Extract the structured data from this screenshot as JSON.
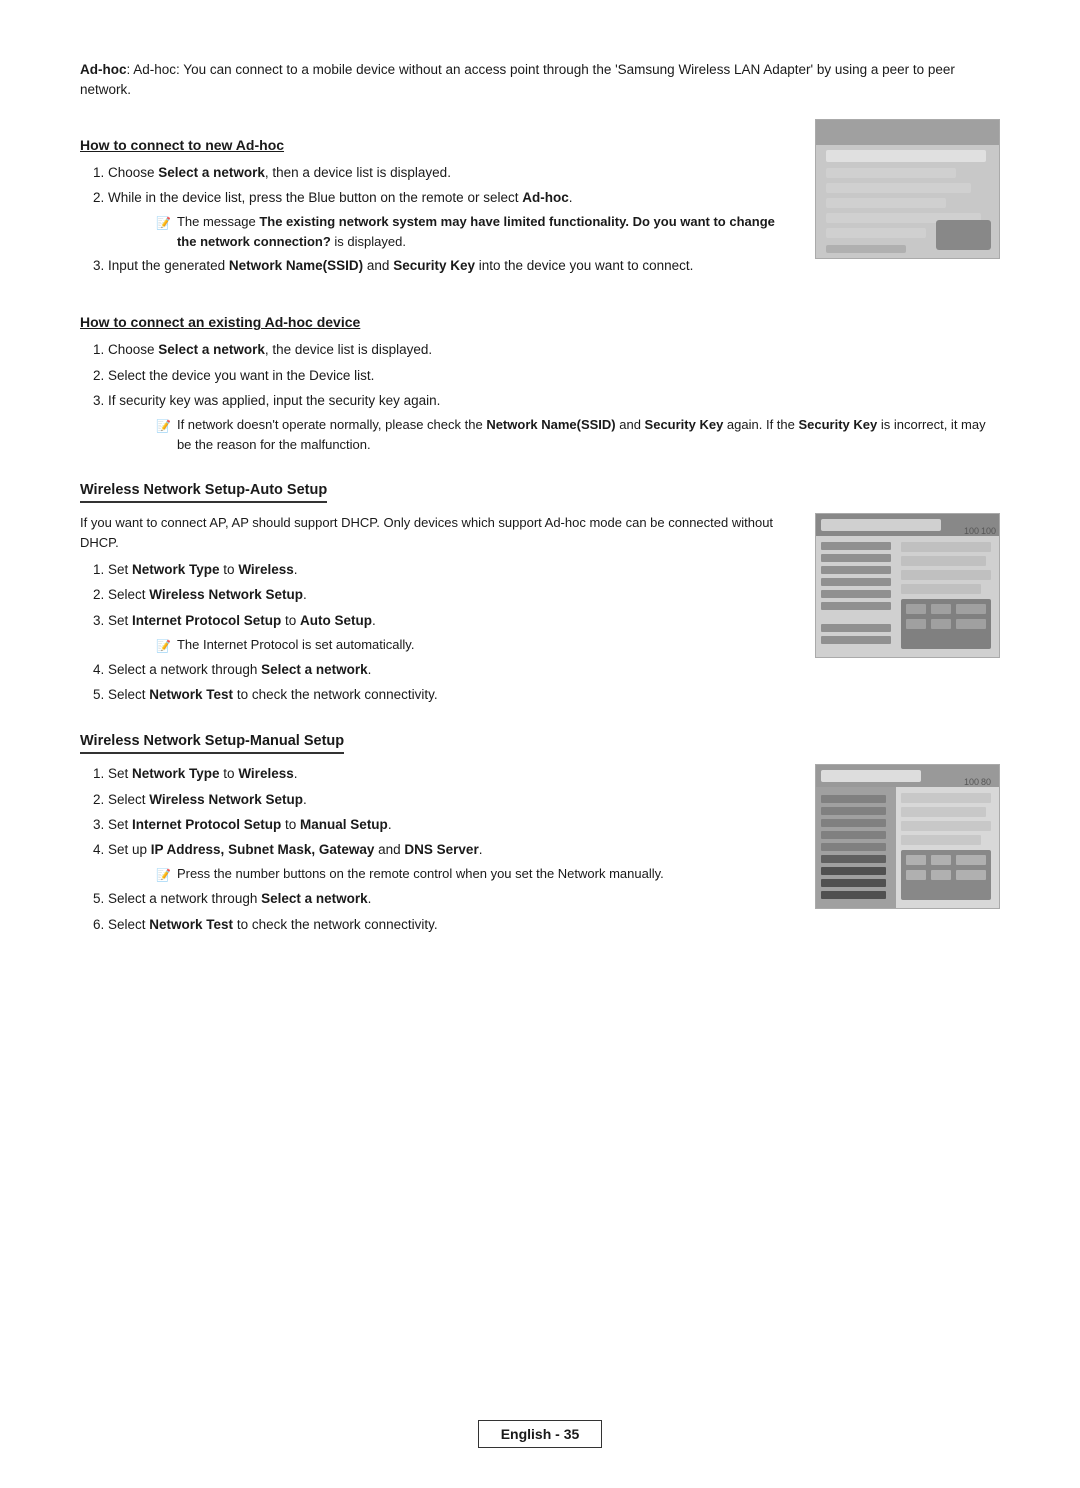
{
  "intro": {
    "text": "Ad-hoc: You can connect to a mobile device without an access point through the 'Samsung Wireless LAN Adapter' by using a peer to peer network."
  },
  "section1": {
    "heading": "How to connect to new Ad-hoc",
    "steps": [
      "Choose Select a network, then a device list is displayed.",
      "While in the device list, press the Blue button on the remote or select Ad-hoc.",
      "Input the generated Network Name(SSID) and Security Key into the device you want to connect."
    ],
    "note": "The message The existing network system may have limited functionality. Do you want to change the network connection? is displayed."
  },
  "section2": {
    "heading": "How to connect an existing Ad-hoc device",
    "steps": [
      "Choose Select a network, the device list is displayed.",
      "Select the device you want in the Device list.",
      "If security key was applied, input the security key again."
    ],
    "note": "If network doesn't operate normally, please check the Network Name(SSID) and Security Key again. If the Security Key is incorrect, it may be the reason for the malfunction."
  },
  "section3": {
    "heading": "Wireless Network Setup-Auto Setup",
    "intro": "If you want to connect AP, AP should support DHCP. Only devices which support Ad-hoc mode can be connected without DHCP.",
    "steps": [
      "Set Network Type to Wireless.",
      "Select Wireless Network Setup.",
      "Set Internet Protocol Setup to Auto Setup.",
      "Select a network through Select a network.",
      "Select Network Test to check the network connectivity."
    ],
    "note": "The Internet Protocol is set automatically."
  },
  "section4": {
    "heading": "Wireless Network Setup-Manual Setup",
    "steps": [
      "Set Network Type to Wireless.",
      "Select Wireless Network Setup.",
      "Set Internet Protocol Setup to Manual Setup.",
      "Set up IP Address, Subnet Mask, Gateway and DNS Server.",
      "Select a network through Select a network.",
      "Select Network Test to check the network connectivity."
    ],
    "note": "Press the number buttons on the remote control when you set the Network manually."
  },
  "footer": {
    "text": "English - 35"
  }
}
